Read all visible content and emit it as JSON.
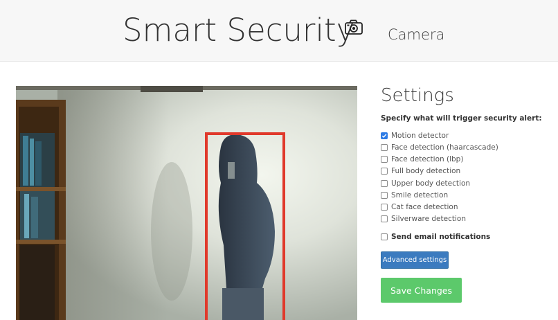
{
  "header": {
    "title": "Smart Security",
    "icon": "camera-icon",
    "subtitle": "Camera"
  },
  "video": {
    "detection_box_color": "#e0392b"
  },
  "settings": {
    "title": "Settings",
    "description": "Specify what will trigger security alert:",
    "options": [
      {
        "label": "Motion detector",
        "checked": true
      },
      {
        "label": "Face detection (haarcascade)",
        "checked": false
      },
      {
        "label": "Face detection (lbp)",
        "checked": false
      },
      {
        "label": "Full body detection",
        "checked": false
      },
      {
        "label": "Upper body detection",
        "checked": false
      },
      {
        "label": "Smile detection",
        "checked": false
      },
      {
        "label": "Cat face detection",
        "checked": false
      },
      {
        "label": "Silverware detection",
        "checked": false
      }
    ],
    "email": {
      "label": "Send email notifications",
      "checked": false
    },
    "advanced_button": "Advanced settings",
    "save_button": "Save Changes"
  },
  "colors": {
    "accent_blue": "#3b7bbf",
    "save_green": "#5cc96b",
    "checkbox_checked": "#2d7be5"
  }
}
